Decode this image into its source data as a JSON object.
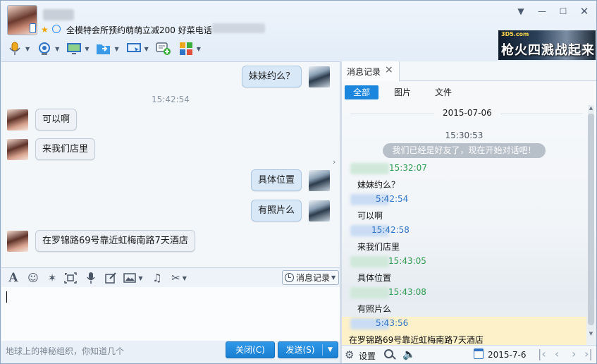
{
  "header": {
    "signature": "全模特会所预约萌萌立减200 好菜电话",
    "window_controls": [
      "chevron-down-icon",
      "minimize-icon",
      "maximize-icon",
      "close-icon"
    ]
  },
  "toolbar": {
    "items": [
      {
        "name": "microphone-icon"
      },
      {
        "name": "webcam-icon"
      },
      {
        "name": "screen-share-icon"
      },
      {
        "name": "file-transfer-icon"
      },
      {
        "name": "remote-desktop-icon"
      },
      {
        "name": "group-chat-icon"
      },
      {
        "name": "apps-icon"
      }
    ]
  },
  "ad": {
    "logo": "3D5.com",
    "text": "枪火四溅战起来"
  },
  "chat": {
    "messages": [
      {
        "side": "right",
        "text": "妹妹约么？"
      },
      {
        "type": "time",
        "text": "15:42:54"
      },
      {
        "side": "left",
        "text": "可以啊"
      },
      {
        "side": "left",
        "text": "来我们店里"
      },
      {
        "side": "right",
        "text": "具体位置"
      },
      {
        "side": "right",
        "text": "有照片么"
      },
      {
        "side": "left",
        "text": "在罗锦路69号靠近虹梅南路7天酒店"
      }
    ]
  },
  "input": {
    "history_button": "消息记录",
    "hint": "地球上的神秘组织，你知道几个",
    "close_button": "关闭(C)",
    "send_button": "发送(S)"
  },
  "history": {
    "tab_label": "消息记录",
    "filters": [
      "全部",
      "图片",
      "文件"
    ],
    "date": "2015-07-06",
    "first_time": "15:30:53",
    "system_message": "我们已经是好友了，现在开始对话吧！",
    "entries": [
      {
        "color": "green",
        "time": "15:32:07",
        "text": "妹妹约么？"
      },
      {
        "color": "blue",
        "time": "5:42:54",
        "text": "可以啊"
      },
      {
        "color": "blue",
        "time": "15:42:58",
        "text": "来我们店里"
      },
      {
        "color": "green",
        "time": "15:43:05",
        "text": "具体位置"
      },
      {
        "color": "green",
        "time": "15:43:08",
        "text": "有照片么"
      },
      {
        "color": "blue",
        "time": "5:43:56",
        "text": "在罗锦路69号靠近虹梅南路7天酒店"
      }
    ],
    "footer": {
      "settings_label": "设置",
      "date": "2015-7-6"
    }
  }
}
